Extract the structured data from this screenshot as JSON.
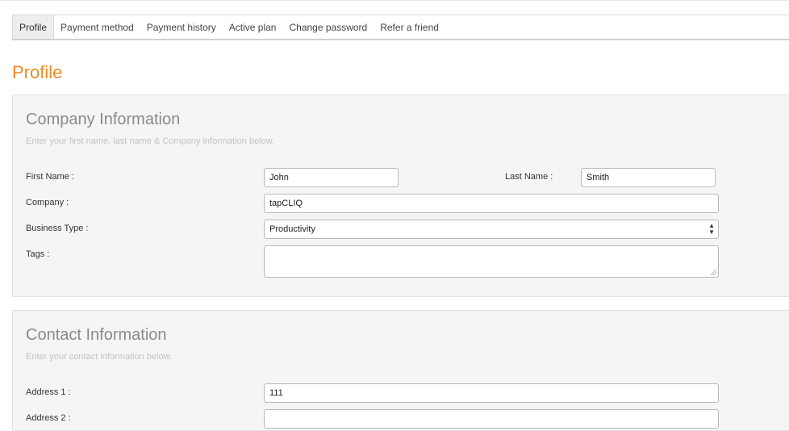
{
  "tabs": [
    {
      "label": "Profile",
      "active": true
    },
    {
      "label": "Payment method"
    },
    {
      "label": "Payment history"
    },
    {
      "label": "Active plan"
    },
    {
      "label": "Change password"
    },
    {
      "label": "Refer a friend"
    }
  ],
  "page_title": "Profile",
  "company": {
    "heading": "Company Information",
    "subheading": "Enter your first name, last name & Company information below.",
    "first_name_label": "First Name :",
    "first_name_value": "John",
    "last_name_label": "Last Name :",
    "last_name_value": "Smith",
    "company_label": "Company :",
    "company_value": "tapCLIQ",
    "business_type_label": "Business Type :",
    "business_type_value": "Productivity",
    "tags_label": "Tags :",
    "tags_value": ""
  },
  "contact": {
    "heading": "Contact Information",
    "subheading": "Enter your contact information below.",
    "address1_label": "Address 1 :",
    "address1_value": "111",
    "address2_label": "Address 2 :",
    "address2_value": ""
  },
  "colors": {
    "accent": "#f08a24",
    "panel_bg": "#f5f5f5"
  }
}
